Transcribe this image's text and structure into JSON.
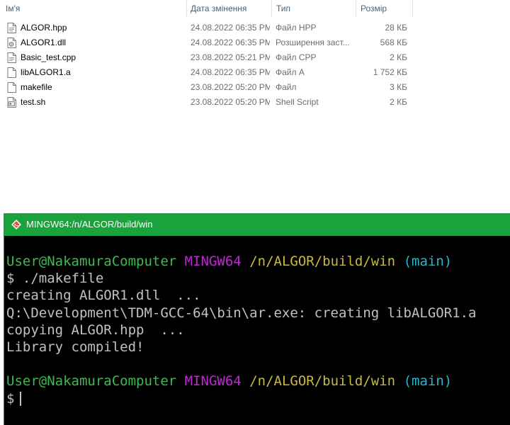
{
  "explorer": {
    "columns": {
      "name": "Ім'я",
      "date": "Дата змінення",
      "type": "Тип",
      "size": "Розмір"
    },
    "files": [
      {
        "name": "ALGOR.hpp",
        "date": "24.08.2022 06:35 PM",
        "type": "Файл HPP",
        "size": "28 КБ",
        "icon": "hpp-file-icon"
      },
      {
        "name": "ALGOR1.dll",
        "date": "24.08.2022 06:35 PM",
        "type": "Розширення заст...",
        "size": "568 КБ",
        "icon": "dll-file-icon"
      },
      {
        "name": "Basic_test.cpp",
        "date": "23.08.2022 05:21 PM",
        "type": "Файл CPP",
        "size": "2 КБ",
        "icon": "cpp-file-icon"
      },
      {
        "name": "libALGOR1.a",
        "date": "24.08.2022 06:35 PM",
        "type": "Файл A",
        "size": "1 752 КБ",
        "icon": "blank-file-icon"
      },
      {
        "name": "makefile",
        "date": "23.08.2022 05:20 PM",
        "type": "Файл",
        "size": "3 КБ",
        "icon": "blank-file-icon"
      },
      {
        "name": "test.sh",
        "date": "23.08.2022 05:20 PM",
        "type": "Shell Script",
        "size": "2 КБ",
        "icon": "shell-script-icon"
      }
    ]
  },
  "terminal": {
    "title": "MINGW64:/n/ALGOR/build/win",
    "prompt": {
      "user_host": "User@NakamuraComputer",
      "env": "MINGW64",
      "path": "/n/ALGOR/build/win",
      "branch": "(main)",
      "symbol": "$"
    },
    "command": "./makefile",
    "output": [
      "creating ALGOR1.dll  ...",
      "Q:\\Development\\TDM-GCC-64\\bin\\ar.exe: creating libALGOR1.a",
      "copying ALGOR.hpp  ...",
      "Library compiled!"
    ]
  },
  "colors": {
    "titlebar": "#1aa33c",
    "prompt_user": "#3fb950",
    "prompt_env": "#c026d3",
    "prompt_path": "#c7ba3d",
    "prompt_branch": "#2bb5c8"
  }
}
